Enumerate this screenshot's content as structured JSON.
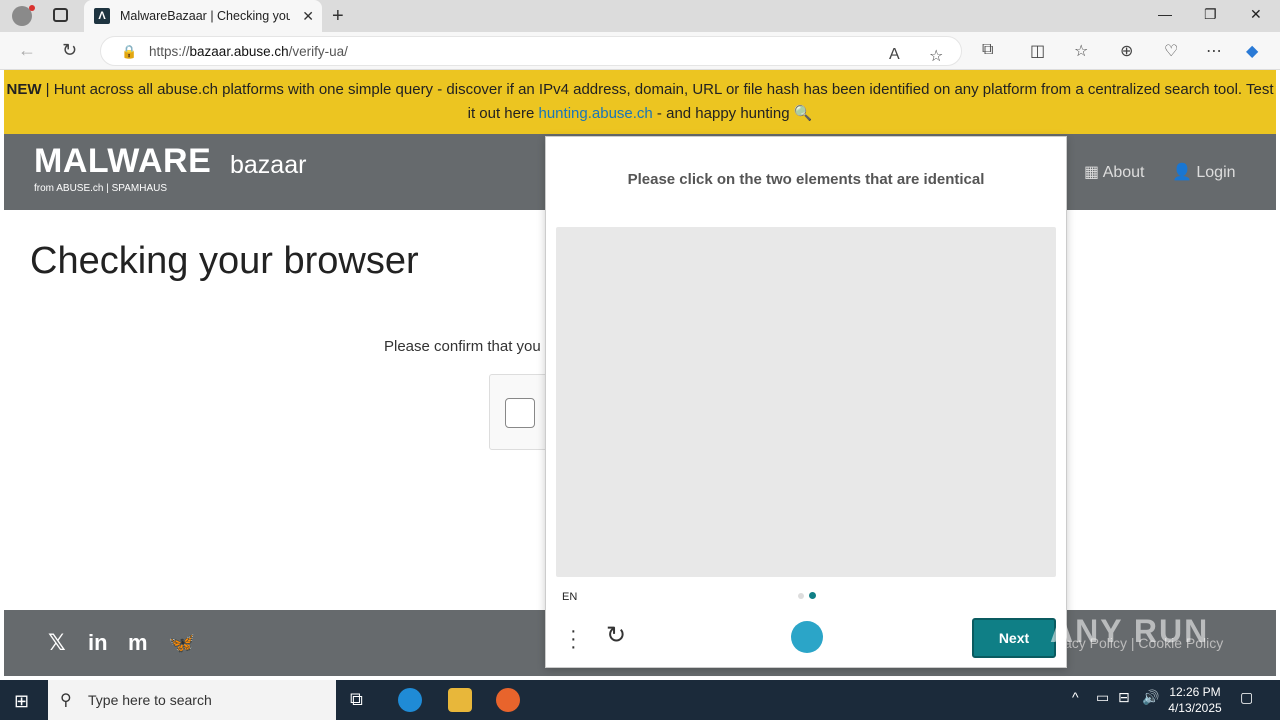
{
  "browser": {
    "tab_title": "MalwareBazaar | Checking your b",
    "url_prefix": "https://",
    "url_host": "bazaar.abuse.ch",
    "url_path": "/verify-ua/"
  },
  "banner": {
    "new_label": "NEW",
    "text_before": " | Hunt across all abuse.ch platforms with one simple query - discover if an IPv4 address, domain, URL or file hash has been identified on any platform from a centralized search tool. Test it out here ",
    "link_text": "hunting.abuse.ch",
    "text_after": " - and happy hunting 🔍"
  },
  "header": {
    "logo_main": "MALWARE",
    "logo_sub": "bazaar",
    "logo_from": "from ABUSE.ch | SPAMHAUS",
    "nav_about": "About",
    "nav_login": "Login"
  },
  "main": {
    "title": "Checking your browser",
    "confirm_text": "Please confirm that you"
  },
  "captcha": {
    "prompt": "Please click on the two elements that are identical",
    "language": "EN",
    "next_label": "Next"
  },
  "footer": {
    "links": "acy Policy  |  Cookie Policy"
  },
  "taskbar": {
    "search_placeholder": "Type here to search",
    "time": "12:26 PM",
    "date": "4/13/2025"
  },
  "watermark": "ANY RUN"
}
